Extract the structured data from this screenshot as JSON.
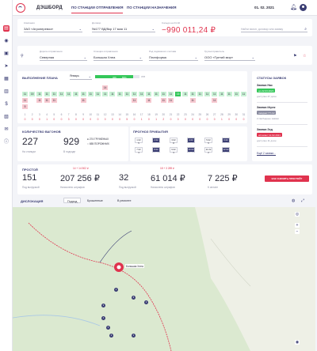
{
  "header": {
    "app_title": "ДЭШБОРД",
    "tabs": [
      {
        "label": "ПО СТАНЦИИ ОТПРАВЛЕНИЯ",
        "active": true
      },
      {
        "label": "ПО СТАНЦИИ НАЗНАЧЕНИЯ",
        "active": false
      }
    ],
    "date": "01. 02. 2021",
    "accent_color": "#e0334e",
    "brand_color": "#3a3d73"
  },
  "filters_row1": {
    "company": {
      "label": "Компания",
      "value": "ЗАО «Агроперевоз»"
    },
    "contract": {
      "label": "Договор",
      "value": "№177 ВД/Вкр 17 мая 11"
    },
    "balance": {
      "label": "Сальдо на 01.02",
      "value": "−990 011,24 ₽"
    },
    "search": {
      "placeholder": "Найти вагон, договор или заявку"
    }
  },
  "filters_row2": {
    "dep_road": {
      "label": "Дорога отправления",
      "value": "Северная"
    },
    "dep_station": {
      "label": "Станция отправления",
      "value": "Большая Хлеа"
    },
    "wagon_type": {
      "label": "Род подвижного состава",
      "value": "Платформа"
    },
    "consignee": {
      "label": "Грузоотправитель",
      "value": "ООО «Третий мир»"
    }
  },
  "plan": {
    "title": "ВЫПОЛНЕНИЕ ПЛАНА",
    "month": "Январь",
    "progress_done": "326",
    "progress_pct": "83",
    "progress_total": "378",
    "progress_fraction": 0.86,
    "rows": [
      {
        "cells": [
          {
            "v": "",
            "c": "none"
          },
          {
            "v": "",
            "c": "none"
          },
          {
            "v": "",
            "c": "none"
          },
          {
            "v": "",
            "c": "none"
          },
          {
            "v": "",
            "c": "none"
          },
          {
            "v": "",
            "c": "none"
          },
          {
            "v": "",
            "c": "none"
          },
          {
            "v": "",
            "c": "none"
          },
          {
            "v": "",
            "c": "none"
          },
          {
            "v": "",
            "c": "none"
          },
          {
            "v": "",
            "c": "none"
          },
          {
            "v": "14",
            "c": "pink"
          },
          {
            "v": "",
            "c": "none"
          },
          {
            "v": "",
            "c": "none"
          },
          {
            "v": "",
            "c": "none"
          },
          {
            "v": "",
            "c": "none"
          },
          {
            "v": "",
            "c": "none"
          },
          {
            "v": "",
            "c": "none"
          },
          {
            "v": "",
            "c": "none"
          },
          {
            "v": "",
            "c": "none"
          },
          {
            "v": "",
            "c": "none"
          },
          {
            "v": "",
            "c": "none"
          },
          {
            "v": "",
            "c": "none"
          },
          {
            "v": "",
            "c": "none"
          },
          {
            "v": "",
            "c": "none"
          },
          {
            "v": "",
            "c": "none"
          },
          {
            "v": "",
            "c": "none"
          },
          {
            "v": "",
            "c": "none"
          },
          {
            "v": "",
            "c": "none"
          },
          {
            "v": "",
            "c": "none"
          },
          {
            "v": "",
            "c": "none"
          }
        ]
      },
      {
        "cells": [
          {
            "v": "11",
            "c": "lgreen"
          },
          {
            "v": "15",
            "c": "lgreen"
          },
          {
            "v": "11",
            "c": "lgreen"
          },
          {
            "v": "11",
            "c": "lgreen"
          },
          {
            "v": "11",
            "c": "lgreen"
          },
          {
            "v": "11",
            "c": "lgreen"
          },
          {
            "v": "11",
            "c": "lgreen"
          },
          {
            "v": "11",
            "c": "lgreen"
          },
          {
            "v": "11",
            "c": "lgreen"
          },
          {
            "v": "11",
            "c": "lgreen"
          },
          {
            "v": "11",
            "c": "lgreen"
          },
          {
            "v": "11",
            "c": "lgreen"
          },
          {
            "v": "11",
            "c": "lgreen"
          },
          {
            "v": "11",
            "c": "lgreen"
          },
          {
            "v": "11",
            "c": "lgreen"
          },
          {
            "v": "11",
            "c": "lgreen"
          },
          {
            "v": "11",
            "c": "lgreen"
          },
          {
            "v": "11",
            "c": "lgreen"
          },
          {
            "v": "11",
            "c": "lgreen"
          },
          {
            "v": "11",
            "c": "lgreen"
          },
          {
            "v": "11",
            "c": "lgreen"
          },
          {
            "v": "15",
            "c": "green"
          },
          {
            "v": "11",
            "c": "lgreen"
          },
          {
            "v": "11",
            "c": "lgreen"
          },
          {
            "v": "11",
            "c": "lgreen"
          },
          {
            "v": "11",
            "c": "lgreen"
          },
          {
            "v": "11",
            "c": "lgreen"
          },
          {
            "v": "11",
            "c": "lgreen"
          },
          {
            "v": "11",
            "c": "lgreen"
          },
          {
            "v": "11",
            "c": "lgreen"
          },
          {
            "v": "11",
            "c": "lgreen"
          }
        ]
      },
      {
        "cells": [
          {
            "v": "11",
            "c": "pink"
          },
          {
            "v": "",
            "c": "none"
          },
          {
            "v": "11",
            "c": "pink"
          },
          {
            "v": "11",
            "c": "pink"
          },
          {
            "v": "11",
            "c": "pink"
          },
          {
            "v": "",
            "c": "none"
          },
          {
            "v": "",
            "c": "none"
          },
          {
            "v": "",
            "c": "none"
          },
          {
            "v": "11",
            "c": "pink"
          },
          {
            "v": "",
            "c": "none"
          },
          {
            "v": "",
            "c": "none"
          },
          {
            "v": "",
            "c": "none"
          },
          {
            "v": "",
            "c": "none"
          },
          {
            "v": "",
            "c": "none"
          },
          {
            "v": "",
            "c": "none"
          },
          {
            "v": "11",
            "c": "pink"
          },
          {
            "v": "",
            "c": "none"
          },
          {
            "v": "11",
            "c": "pink"
          },
          {
            "v": "",
            "c": "none"
          },
          {
            "v": "11",
            "c": "pink"
          },
          {
            "v": "11",
            "c": "pink"
          },
          {
            "v": "",
            "c": "none"
          },
          {
            "v": "",
            "c": "none"
          },
          {
            "v": "11",
            "c": "pink"
          },
          {
            "v": "",
            "c": "none"
          },
          {
            "v": "",
            "c": "none"
          },
          {
            "v": "11",
            "c": "pink"
          },
          {
            "v": "",
            "c": "none"
          },
          {
            "v": "",
            "c": "none"
          },
          {
            "v": "",
            "c": "none"
          },
          {
            "v": "",
            "c": "none"
          }
        ]
      },
      {
        "cells": [
          {
            "v": "5",
            "c": "pink"
          },
          {
            "v": "",
            "c": "none"
          },
          {
            "v": "",
            "c": "none"
          },
          {
            "v": "",
            "c": "none"
          },
          {
            "v": "",
            "c": "none"
          },
          {
            "v": "",
            "c": "none"
          },
          {
            "v": "",
            "c": "none"
          },
          {
            "v": "",
            "c": "none"
          },
          {
            "v": "",
            "c": "none"
          },
          {
            "v": "",
            "c": "none"
          },
          {
            "v": "",
            "c": "none"
          },
          {
            "v": "",
            "c": "none"
          },
          {
            "v": "",
            "c": "none"
          },
          {
            "v": "",
            "c": "none"
          },
          {
            "v": "",
            "c": "none"
          },
          {
            "v": "",
            "c": "none"
          },
          {
            "v": "",
            "c": "none"
          },
          {
            "v": "",
            "c": "none"
          },
          {
            "v": "",
            "c": "none"
          },
          {
            "v": "",
            "c": "none"
          },
          {
            "v": "",
            "c": "none"
          },
          {
            "v": "",
            "c": "none"
          },
          {
            "v": "",
            "c": "none"
          },
          {
            "v": "",
            "c": "none"
          },
          {
            "v": "",
            "c": "none"
          },
          {
            "v": "",
            "c": "none"
          },
          {
            "v": "",
            "c": "none"
          },
          {
            "v": "",
            "c": "none"
          },
          {
            "v": "",
            "c": "none"
          },
          {
            "v": "",
            "c": "none"
          },
          {
            "v": "",
            "c": "none"
          }
        ]
      }
    ],
    "days": [
      "1",
      "2",
      "3",
      "4",
      "5",
      "6",
      "7",
      "8",
      "9",
      "10",
      "11",
      "12",
      "13",
      "14",
      "15",
      "16",
      "17",
      "18",
      "19",
      "20",
      "21",
      "22",
      "23",
      "24",
      "25",
      "26",
      "27",
      "28",
      "29",
      "30",
      "31"
    ],
    "bottom": [
      "0",
      "0",
      "0",
      "1",
      "0",
      "0",
      "3",
      "0",
      "0",
      "0",
      "0",
      "0",
      "0",
      "0",
      "5",
      "0",
      "1",
      "0",
      "1",
      "2",
      "0",
      "0",
      "0",
      "0",
      "0",
      "0",
      "0",
      "1",
      "0",
      "0",
      "0"
    ]
  },
  "wagons": {
    "title": "КОЛИЧЕСТВО ВАГОНОВ",
    "on_station": "227",
    "on_station_label": "На станции",
    "on_route": "929",
    "on_route_label": "В подходе",
    "loaded": "274 ГРУЖЕНЫХ",
    "empty": "655 ПОРОЖНИХ"
  },
  "forecast": {
    "title": "ПРОГНОЗ ПРИБЫТИЯ",
    "cells": [
      {
        "t": "1.02",
        "v": "5",
        "dark": false
      },
      {
        "t": "2.02",
        "v": "6",
        "dark": true
      },
      {
        "t": "3.02",
        "v": "8",
        "dark": false
      },
      {
        "t": "4.02",
        "v": "3",
        "dark": true
      },
      {
        "t": "5.02",
        "v": "5",
        "dark": false
      },
      {
        "t": "6.02",
        "v": "7",
        "dark": true
      },
      {
        "t": "7.02",
        "v": "4",
        "dark": false
      },
      {
        "t": "8.02",
        "v": "10",
        "dark": true
      },
      {
        "t": "9.02",
        "v": "3",
        "dark": false
      },
      {
        "t": "10.02",
        "v": "8",
        "dark": true
      },
      {
        "t": "11.02",
        "v": "2",
        "dark": false
      },
      {
        "t": "12.02",
        "v": "6",
        "dark": true
      }
    ]
  },
  "status": {
    "title": "СТАТУСЫ ЗАЯВОК",
    "items": [
      {
        "name": "Заявка Нас",
        "badge": "до 22.03.2021",
        "badge_color": "#34c759",
        "sub": "доступно 47 длин"
      },
      {
        "name": "Заявка Игрек",
        "badge": "ожидает ГУ-12",
        "badge_color": "#8a8ca0",
        "sub": "2 свободные заявки"
      },
      {
        "name": "Заявка Зед",
        "badge": "истекает 12.02.2021",
        "badge_color": "#e0334e",
        "sub": "доступно 11 длин"
      }
    ],
    "more": "Ещё 2 заявки..."
  },
  "idle": {
    "title": "ПРОСТОЙ",
    "a_delta": "14 + 14 502 ₽",
    "a_count": "151",
    "a_count_label": "Под выгрузкой",
    "a_amount": "207 256 ₽",
    "a_amount_label": "Начислено штрафов",
    "b_delta": "18 + 3 289 ₽",
    "b_count": "32",
    "b_count_label": "Под выгрузкой",
    "b_amount": "61 014 ₽",
    "b_amount_label": "Начислено штрафов",
    "c_amount": "7 225 ₽",
    "c_amount_label": "К оплате",
    "action": "КАК СНИЗИТЬ ПРОСТОЙ?"
  },
  "map": {
    "title": "ДИСЛОКАЦИЯ",
    "tabs": [
      "Подход",
      "Брошенные",
      "В ремонте"
    ],
    "active_tab": 0,
    "station_label": "Большая Хлеа",
    "pins": [
      "4",
      "8",
      "3",
      "9",
      "4",
      "5",
      "6",
      "3"
    ]
  }
}
